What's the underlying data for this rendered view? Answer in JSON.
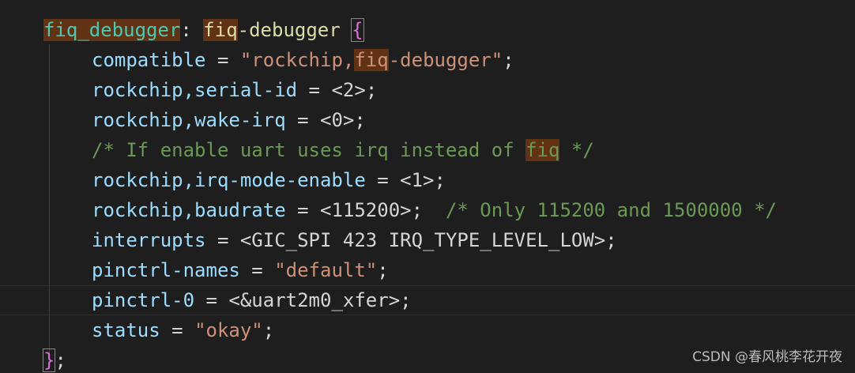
{
  "lines": [
    {
      "node": "fiq_debugger",
      "colon": ": ",
      "label_hl": "fiq",
      "label_rest": "-debugger",
      "space": " ",
      "brace": "{"
    },
    {
      "prop": "compatible",
      "eq": " = ",
      "str_a": "\"rockchip,",
      "str_hl": "fiq",
      "str_b": "-debugger\"",
      "semi": ";"
    },
    {
      "prop": "rockchip,serial-id",
      "eq": " = ",
      "val": "<2>",
      "semi": ";"
    },
    {
      "prop": "rockchip,wake-irq",
      "eq": " = ",
      "val": "<0>",
      "semi": ";"
    },
    {
      "cmt_a": "/* If enable uart uses irq instead of ",
      "cmt_hl": "fiq",
      "cmt_b": " */"
    },
    {
      "prop": "rockchip,irq-mode-enable",
      "eq": " = ",
      "val": "<1>",
      "semi": ";"
    },
    {
      "prop": "rockchip,baudrate",
      "eq": " = ",
      "val": "<115200>",
      "semi": ";",
      "cmt": "  /* Only 115200 and 1500000 */"
    },
    {
      "prop": "interrupts",
      "eq": " = ",
      "val": "<GIC_SPI 423 IRQ_TYPE_LEVEL_LOW>",
      "semi": ";"
    },
    {
      "prop": "pinctrl-names",
      "eq": " = ",
      "str": "\"default\"",
      "semi": ";"
    },
    {
      "prop": "pinctrl-0",
      "eq": " = ",
      "val": "<&uart2m0_xfer>",
      "semi": ";"
    },
    {
      "prop": "status",
      "eq": " = ",
      "str": "\"okay\"",
      "semi": ";"
    },
    {
      "brace": "}",
      "semi": ";"
    }
  ],
  "watermark": "CSDN @春风桃李花开夜",
  "colors": {
    "background": "#1e1e1e",
    "node": "#4ec9b0",
    "label": "#dcdcaa",
    "property": "#9cdcfe",
    "string": "#ce9178",
    "comment": "#6a9955",
    "bracket": "#da70d6",
    "find_highlight": "#613214"
  }
}
